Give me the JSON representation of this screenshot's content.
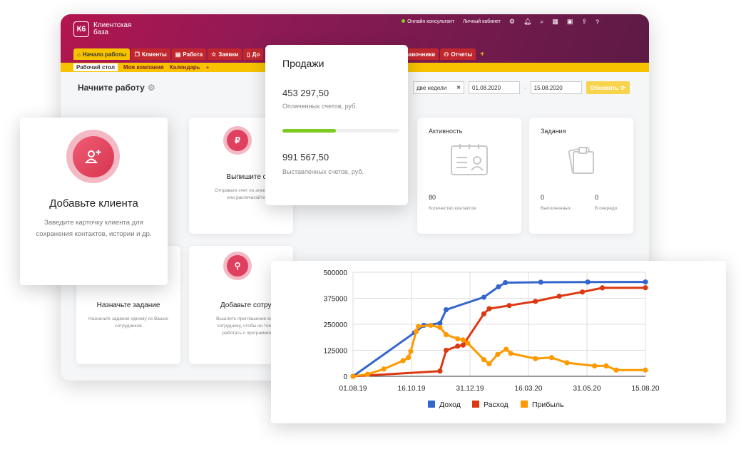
{
  "app": {
    "logo_mark": "К6",
    "logo_line1": "Клиентская",
    "logo_line2": "база",
    "online_consultant": "Онлайн консультант",
    "personal_account": "Личный кабинет",
    "tabs": [
      "Начало работы",
      "Клиенты",
      "Работа",
      "Заявки",
      "До",
      "равочники",
      "Отчеты"
    ],
    "subtabs": [
      "Рабочий стол",
      "Моя компания",
      "Календарь"
    ],
    "plus": "+",
    "page_title": "Начните работу",
    "filter_period": "две недели",
    "filter_clear": "✖",
    "date_from": "01.08.2020",
    "date_sep": "-",
    "date_to": "15.08.2020",
    "refresh_label": "Обновить"
  },
  "cards": {
    "invoice_title": "Выпишите счет",
    "invoice_desc1": "Отправьте счет по электронн",
    "invoice_desc2": "или распечатайте",
    "task_title": "Назначьте задание",
    "task_desc1": "Назначьте задание одному из Ваших",
    "task_desc2": "сотрудников",
    "employee_title": "Добавьте сотрудни",
    "employee_desc1": "Вышлите приглашение ваше",
    "employee_desc2": "сотруднику, чтобы он тоже с",
    "employee_desc3": "работать с программой",
    "activity_title": "Активность",
    "activity_value": "80",
    "activity_caption": "Количество контактов",
    "tasks_title": "Задания",
    "tasks_done_value": "0",
    "tasks_done_caption": "Выполненных",
    "tasks_queue_value": "0",
    "tasks_queue_caption": "В очереди"
  },
  "client_card": {
    "title": "Добавьте клиента",
    "desc1": "Заведите карточку клиента для",
    "desc2": "сохранения контактов, истории и др."
  },
  "sales": {
    "title": "Продажи",
    "paid_value": "453 297,50",
    "paid_caption": "Оплаченных счетов, руб.",
    "paid_progress": 0.46,
    "issued_value": "991 567,50",
    "issued_caption": "Выставленных счетов, руб."
  },
  "colors": {
    "income": "#3366cc",
    "expense": "#dc3912",
    "profit": "#ff9900",
    "accent": "#f7c300",
    "brand": "#c0282e"
  },
  "chart_data": {
    "type": "line",
    "x_ticks": [
      "01.08.19",
      "16.10.19",
      "31.12.19",
      "16.03.20",
      "31.05.20",
      "15.08.20"
    ],
    "y_ticks": [
      "0",
      "125000",
      "250000",
      "375000",
      "500000"
    ],
    "ylim": [
      0,
      500000
    ],
    "xlim": [
      "2019-08-01",
      "2020-08-15"
    ],
    "legend_position": "bottom",
    "series": [
      {
        "name": "Доход",
        "color": "#3366cc",
        "points": [
          [
            "2019-08-01",
            0
          ],
          [
            "2019-10-20",
            210000
          ],
          [
            "2019-11-01",
            245000
          ],
          [
            "2019-11-22",
            255000
          ],
          [
            "2019-11-30",
            320000
          ],
          [
            "2020-01-18",
            380000
          ],
          [
            "2020-02-06",
            430000
          ],
          [
            "2020-02-15",
            450000
          ],
          [
            "2020-04-01",
            452000
          ],
          [
            "2020-06-01",
            453000
          ],
          [
            "2020-08-15",
            453300
          ]
        ]
      },
      {
        "name": "Расход",
        "color": "#dc3912",
        "points": [
          [
            "2019-08-01",
            0
          ],
          [
            "2019-11-22",
            25000
          ],
          [
            "2019-11-30",
            125000
          ],
          [
            "2019-12-15",
            145000
          ],
          [
            "2019-12-22",
            150000
          ],
          [
            "2020-01-18",
            300000
          ],
          [
            "2020-01-25",
            325000
          ],
          [
            "2020-02-20",
            340000
          ],
          [
            "2020-03-25",
            360000
          ],
          [
            "2020-04-25",
            385000
          ],
          [
            "2020-05-25",
            405000
          ],
          [
            "2020-06-20",
            425000
          ],
          [
            "2020-08-15",
            425500
          ]
        ]
      },
      {
        "name": "Прибыль",
        "color": "#ff9900",
        "points": [
          [
            "2019-08-01",
            0
          ],
          [
            "2019-08-20",
            10000
          ],
          [
            "2019-09-10",
            35000
          ],
          [
            "2019-10-05",
            75000
          ],
          [
            "2019-10-12",
            90000
          ],
          [
            "2019-10-15",
            120000
          ],
          [
            "2019-10-22",
            215000
          ],
          [
            "2019-10-25",
            240000
          ],
          [
            "2019-11-10",
            245000
          ],
          [
            "2019-11-22",
            235000
          ],
          [
            "2019-11-30",
            200000
          ],
          [
            "2019-12-15",
            180000
          ],
          [
            "2019-12-22",
            175000
          ],
          [
            "2019-12-28",
            160000
          ],
          [
            "2020-01-18",
            80000
          ],
          [
            "2020-01-25",
            60000
          ],
          [
            "2020-02-05",
            105000
          ],
          [
            "2020-02-16",
            130000
          ],
          [
            "2020-02-22",
            110000
          ],
          [
            "2020-03-25",
            85000
          ],
          [
            "2020-04-15",
            90000
          ],
          [
            "2020-05-05",
            65000
          ],
          [
            "2020-06-10",
            50000
          ],
          [
            "2020-06-25",
            50000
          ],
          [
            "2020-07-08",
            30000
          ],
          [
            "2020-08-15",
            30000
          ]
        ]
      }
    ]
  }
}
